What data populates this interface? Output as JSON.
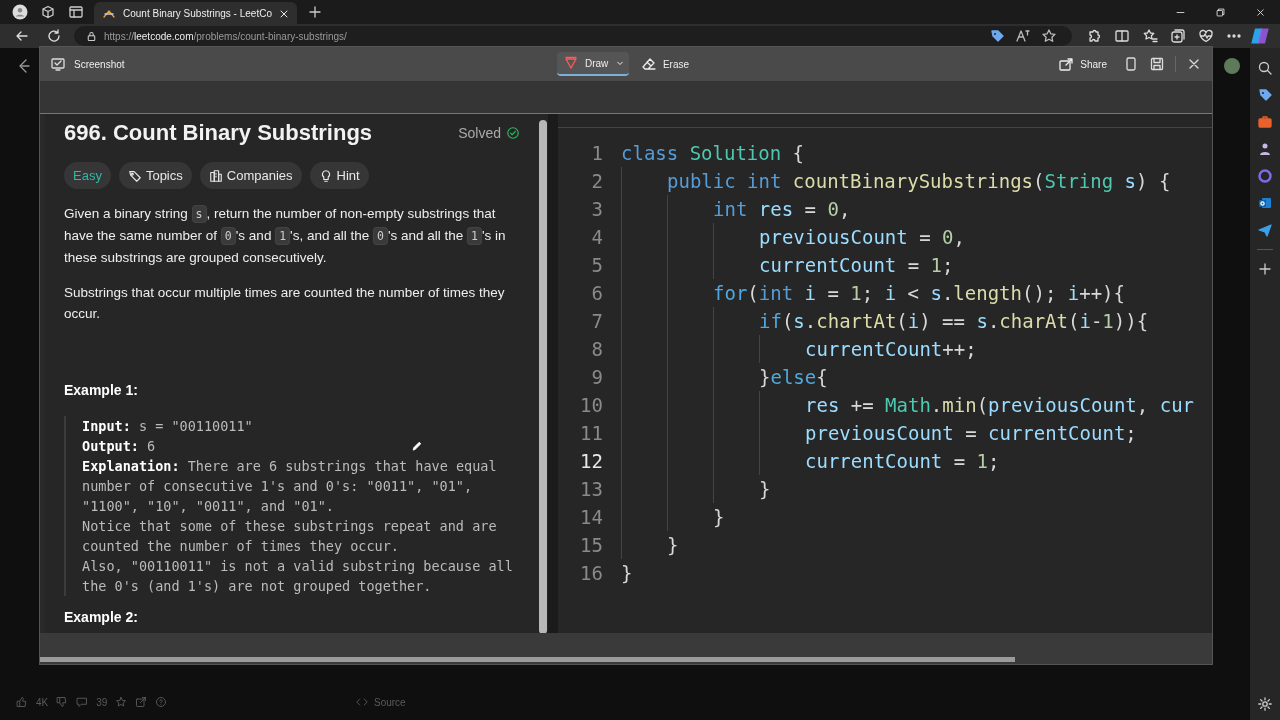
{
  "browser": {
    "tabs": [
      {
        "title": "Count Binary Substrings - LeetCo",
        "selected": true
      }
    ],
    "url": {
      "scheme": "https://",
      "host": "leetcode.com",
      "path": "/problems/count-binary-substrings/"
    }
  },
  "screenshot_toolbar": {
    "title": "Screenshot",
    "tools": [
      {
        "label": "Draw",
        "kind": "draw",
        "selected": true
      },
      {
        "label": "Erase",
        "kind": "erase",
        "selected": false
      }
    ],
    "share": "Share"
  },
  "problem": {
    "title": "696. Count Binary Substrings",
    "status": {
      "text": "Solved",
      "solved": true
    },
    "tags": [
      {
        "label": "Easy",
        "kind": "difficulty"
      },
      {
        "label": "Topics",
        "kind": "topics"
      },
      {
        "label": "Companies",
        "kind": "companies"
      },
      {
        "label": "Hint",
        "kind": "hint"
      }
    ],
    "paragraphs": [
      [
        {
          "text": "Given a binary string "
        },
        {
          "code": "s"
        },
        {
          "text": ", return the number of non-empty substrings that have the same number of "
        },
        {
          "code": "0"
        },
        {
          "text": "'s and "
        },
        {
          "code": "1"
        },
        {
          "text": "'s, and all the "
        },
        {
          "code": "0"
        },
        {
          "text": "'s and all the "
        },
        {
          "code": "1"
        },
        {
          "text": "'s in these substrings are grouped consecutively."
        }
      ],
      [
        {
          "text": "Substrings that occur multiple times are counted the number of times they occur."
        }
      ]
    ],
    "examples": [
      {
        "title": "Example 1:",
        "lines": [
          "**Input:** s = \"00110011\"",
          "**Output:** 6",
          "**Explanation:** There are 6 substrings that have equal number of consecutive 1's and 0's: \"0011\", \"01\", \"1100\", \"10\", \"0011\", and \"01\".\nNotice that some of these substrings repeat and are counted the number of times they occur.\nAlso, \"00110011\" is not a valid substring because all the 0's (and 1's) are not grouped together."
        ]
      },
      {
        "title": "Example 2:"
      }
    ]
  },
  "editor": {
    "lines": [
      {
        "number": "1",
        "current": false,
        "tokens": [
          {
            "t": "class",
            "kind": "kw"
          },
          {
            "t": " Solution",
            "kind": "type"
          },
          {
            "t": " {",
            "kind": "plain"
          }
        ],
        "children": [
          {
            "number": "2",
            "current": false,
            "tokens": [
              {
                "t": "public",
                "kind": "kw"
              },
              {
                "t": " int",
                "kind": "kw"
              },
              {
                "t": " countBinarySubstrings",
                "kind": "fn"
              },
              {
                "t": "(",
                "kind": "plain"
              },
              {
                "t": "String",
                "kind": "type"
              },
              {
                "t": " s",
                "kind": "var"
              },
              {
                "t": ") {",
                "kind": "plain"
              }
            ],
            "children": [
              {
                "number": "3",
                "current": false,
                "tokens": [
                  {
                    "t": "int",
                    "kind": "kw"
                  },
                  {
                    "t": " res",
                    "kind": "var"
                  },
                  {
                    "t": " = ",
                    "kind": "plain"
                  },
                  {
                    "t": "0",
                    "kind": "num"
                  },
                  {
                    "t": ",",
                    "kind": "plain"
                  }
                ],
                "children": [
                  {
                    "number": "4",
                    "current": false,
                    "tokens": [
                      {
                        "t": "previousCount",
                        "kind": "var"
                      },
                      {
                        "t": " = ",
                        "kind": "plain"
                      },
                      {
                        "t": "0",
                        "kind": "num"
                      },
                      {
                        "t": ",",
                        "kind": "plain"
                      }
                    ]
                  },
                  {
                    "number": "5",
                    "current": false,
                    "tokens": [
                      {
                        "t": "currentCount",
                        "kind": "var"
                      },
                      {
                        "t": " = ",
                        "kind": "plain"
                      },
                      {
                        "t": "1",
                        "kind": "num"
                      },
                      {
                        "t": ";",
                        "kind": "plain"
                      }
                    ]
                  }
                ]
              },
              {
                "number": "6",
                "current": false,
                "tokens": [
                  {
                    "t": "for",
                    "kind": "ctl"
                  },
                  {
                    "t": "(",
                    "kind": "plain"
                  },
                  {
                    "t": "int",
                    "kind": "kw"
                  },
                  {
                    "t": " i",
                    "kind": "var"
                  },
                  {
                    "t": " = ",
                    "kind": "plain"
                  },
                  {
                    "t": "1",
                    "kind": "num"
                  },
                  {
                    "t": "; ",
                    "kind": "plain"
                  },
                  {
                    "t": "i",
                    "kind": "var"
                  },
                  {
                    "t": " < ",
                    "kind": "plain"
                  },
                  {
                    "t": "s",
                    "kind": "var"
                  },
                  {
                    "t": ".",
                    "kind": "plain"
                  },
                  {
                    "t": "length",
                    "kind": "fn"
                  },
                  {
                    "t": "(); ",
                    "kind": "plain"
                  },
                  {
                    "t": "i",
                    "kind": "var"
                  },
                  {
                    "t": "++){",
                    "kind": "plain"
                  }
                ],
                "children": [
                  {
                    "number": "7",
                    "current": false,
                    "tokens": [
                      {
                        "t": "if",
                        "kind": "ctl"
                      },
                      {
                        "t": "(",
                        "kind": "plain"
                      },
                      {
                        "t": "s",
                        "kind": "var"
                      },
                      {
                        "t": ".",
                        "kind": "plain"
                      },
                      {
                        "t": "chartAt",
                        "kind": "fn"
                      },
                      {
                        "t": "(",
                        "kind": "plain"
                      },
                      {
                        "t": "i",
                        "kind": "var"
                      },
                      {
                        "t": ") == ",
                        "kind": "plain"
                      },
                      {
                        "t": "s",
                        "kind": "var"
                      },
                      {
                        "t": ".",
                        "kind": "plain"
                      },
                      {
                        "t": "charAt",
                        "kind": "fn"
                      },
                      {
                        "t": "(",
                        "kind": "plain"
                      },
                      {
                        "t": "i",
                        "kind": "var"
                      },
                      {
                        "t": "-",
                        "kind": "plain"
                      },
                      {
                        "t": "1",
                        "kind": "num"
                      },
                      {
                        "t": ")){",
                        "kind": "plain"
                      }
                    ],
                    "children": [
                      {
                        "number": "8",
                        "current": false,
                        "tokens": [
                          {
                            "t": "currentCount",
                            "kind": "var"
                          },
                          {
                            "t": "++;",
                            "kind": "plain"
                          }
                        ]
                      }
                    ]
                  },
                  {
                    "number": "9",
                    "current": false,
                    "tokens": [
                      {
                        "t": "}",
                        "kind": "plain"
                      },
                      {
                        "t": "else",
                        "kind": "ctl"
                      },
                      {
                        "t": "{",
                        "kind": "plain"
                      }
                    ],
                    "children": [
                      {
                        "number": "10",
                        "current": false,
                        "tokens": [
                          {
                            "t": "res",
                            "kind": "var"
                          },
                          {
                            "t": " += ",
                            "kind": "plain"
                          },
                          {
                            "t": "Math",
                            "kind": "type"
                          },
                          {
                            "t": ".",
                            "kind": "plain"
                          },
                          {
                            "t": "min",
                            "kind": "fn"
                          },
                          {
                            "t": "(",
                            "kind": "plain"
                          },
                          {
                            "t": "previousCount",
                            "kind": "var"
                          },
                          {
                            "t": ", ",
                            "kind": "plain"
                          },
                          {
                            "t": "cur",
                            "kind": "var"
                          }
                        ]
                      },
                      {
                        "number": "11",
                        "current": false,
                        "tokens": [
                          {
                            "t": "previousCount",
                            "kind": "var"
                          },
                          {
                            "t": " = ",
                            "kind": "plain"
                          },
                          {
                            "t": "currentCount",
                            "kind": "var"
                          },
                          {
                            "t": ";",
                            "kind": "plain"
                          }
                        ]
                      },
                      {
                        "number": "12",
                        "current": true,
                        "tokens": [
                          {
                            "t": "currentCount",
                            "kind": "var"
                          },
                          {
                            "t": " = ",
                            "kind": "plain"
                          },
                          {
                            "t": "1",
                            "kind": "num"
                          },
                          {
                            "t": ";",
                            "kind": "plain"
                          }
                        ]
                      }
                    ]
                  },
                  {
                    "number": "13",
                    "current": false,
                    "tokens": [
                      {
                        "t": "}",
                        "kind": "plain"
                      }
                    ]
                  }
                ]
              },
              {
                "number": "14",
                "current": false,
                "tokens": [
                  {
                    "t": "}",
                    "kind": "plain"
                  }
                ]
              }
            ]
          },
          {
            "number": "15",
            "current": false,
            "tokens": [
              {
                "t": "}",
                "kind": "plain"
              }
            ]
          }
        ]
      },
      {
        "number": "16",
        "current": false,
        "tokens": [
          {
            "t": "}",
            "kind": "plain"
          }
        ]
      }
    ]
  },
  "page_footer": {
    "likes": "4K",
    "comments": "39",
    "source": "Source"
  }
}
